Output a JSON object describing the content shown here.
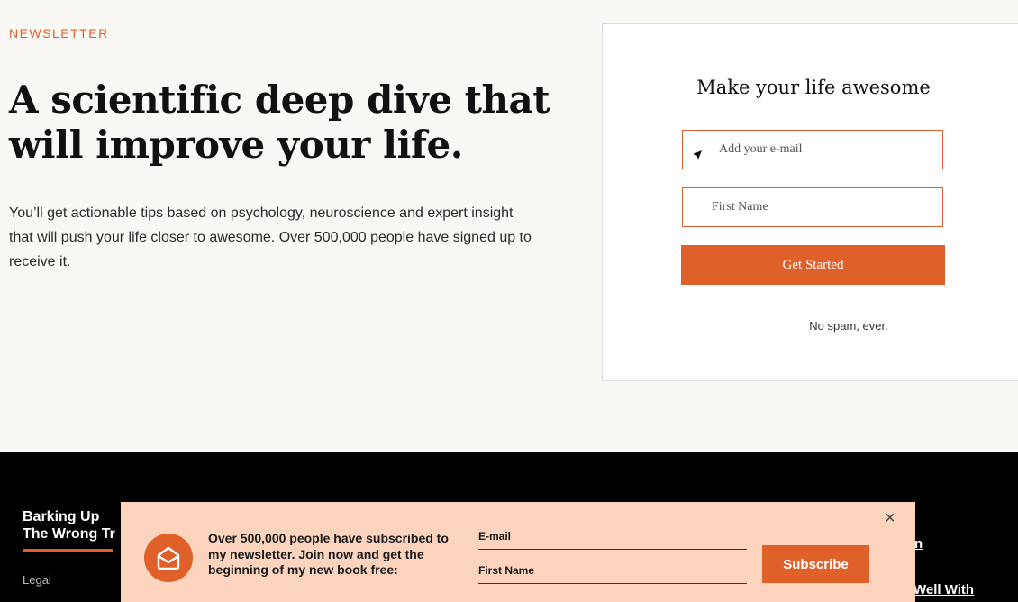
{
  "hero": {
    "eyebrow": "NEWSLETTER",
    "headline": "A scientific deep dive that will improve your life.",
    "description": "You’ll get actionable tips based on psychology, neuroscience and expert insight that will push your life closer to awesome. Over 500,000 people have signed up to receive it."
  },
  "signup_card": {
    "title": "Make your life awesome",
    "email_placeholder": "Add your e-mail",
    "name_placeholder": "First Name",
    "button_label": "Get Started",
    "note": "No spam, ever."
  },
  "footer": {
    "brand_line1": "Barking Up",
    "brand_line2": "The Wrong Tr",
    "legal": "Legal",
    "link_partial_1": "n",
    "link_partial_2": "Well With"
  },
  "popup": {
    "text": "Over 500,000 people have subscribed to my newsletter. Join now and get the beginning of my new book free:",
    "email_label": "E-mail",
    "name_label": "First Name",
    "button_label": "Subscribe",
    "close_glyph": "×"
  },
  "colors": {
    "accent": "#e0602a",
    "popup_bg": "#fcd3bd",
    "page_bg": "#f9f8f4"
  }
}
